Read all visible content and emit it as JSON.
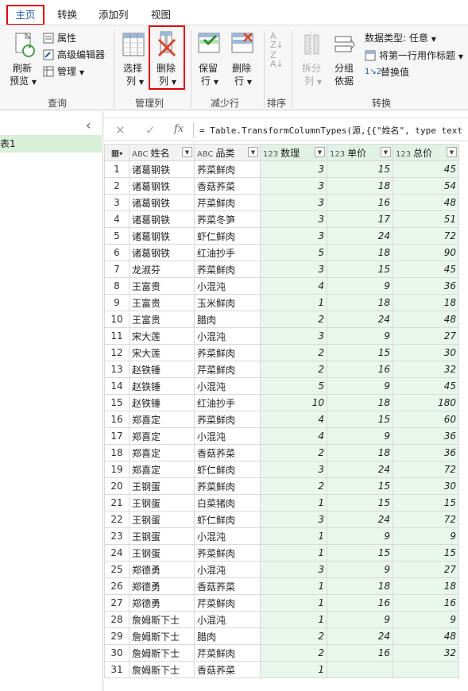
{
  "tabs": [
    {
      "label": "主页"
    },
    {
      "label": "转换"
    },
    {
      "label": "添加列"
    },
    {
      "label": "视图"
    }
  ],
  "ribbon": {
    "query": {
      "group_label": "查询",
      "refresh_line1": "刷新",
      "refresh_line2": "预览",
      "properties": "属性",
      "advanced_editor": "高级编辑器",
      "manage": "管理"
    },
    "manage_columns": {
      "group_label": "管理列",
      "choose_line1": "选择",
      "choose_line2": "列",
      "remove_line1": "删除",
      "remove_line2": "列"
    },
    "reduce_rows": {
      "group_label": "减少行",
      "keep_line1": "保留",
      "keep_line2": "行",
      "remove_line1": "删除",
      "remove_line2": "行"
    },
    "sort": {
      "group_label": "排序"
    },
    "transform": {
      "group_label": "转换",
      "split_line1": "拆分",
      "split_line2": "列",
      "group_line1": "分组",
      "group_line2": "依据",
      "data_type": "数据类型: 任意",
      "first_row_header": "将第一行用作标题",
      "replace_values": "替换值"
    }
  },
  "left_pane": {
    "query_name": "表1"
  },
  "formula_bar": {
    "text": "= Table.TransformColumnTypes(源,{{\"姓名\", type text"
  },
  "table": {
    "columns": [
      {
        "type": "ABC",
        "name": "姓名"
      },
      {
        "type": "ABC",
        "name": "品类"
      },
      {
        "type": "123",
        "name": "数理"
      },
      {
        "type": "123",
        "name": "单价"
      },
      {
        "type": "123",
        "name": "总价"
      }
    ],
    "rows": [
      [
        "1",
        "诸葛钢铁",
        "荞菜鲜肉",
        "3",
        "15",
        "45"
      ],
      [
        "2",
        "诸葛钢铁",
        "香菇荞菜",
        "3",
        "18",
        "54"
      ],
      [
        "3",
        "诸葛钢铁",
        "芹菜鲜肉",
        "3",
        "16",
        "48"
      ],
      [
        "4",
        "诸葛钢铁",
        "荞菜冬笋",
        "3",
        "17",
        "51"
      ],
      [
        "5",
        "诸葛钢铁",
        "虾仁鲜肉",
        "3",
        "24",
        "72"
      ],
      [
        "6",
        "诸葛钢铁",
        "红油抄手",
        "5",
        "18",
        "90"
      ],
      [
        "7",
        "龙淑芬",
        "荞菜鲜肉",
        "3",
        "15",
        "45"
      ],
      [
        "8",
        "王富贵",
        "小混沌",
        "4",
        "9",
        "36"
      ],
      [
        "9",
        "王富贵",
        "玉米鲜肉",
        "1",
        "18",
        "18"
      ],
      [
        "10",
        "王富贵",
        "腊肉",
        "2",
        "24",
        "48"
      ],
      [
        "11",
        "宋大莲",
        "小混沌",
        "3",
        "9",
        "27"
      ],
      [
        "12",
        "宋大莲",
        "荞菜鲜肉",
        "2",
        "15",
        "30"
      ],
      [
        "13",
        "赵铁锤",
        "芹菜鲜肉",
        "2",
        "16",
        "32"
      ],
      [
        "14",
        "赵铁锤",
        "小混沌",
        "5",
        "9",
        "45"
      ],
      [
        "15",
        "赵铁锤",
        "红油抄手",
        "10",
        "18",
        "180"
      ],
      [
        "16",
        "郑喜定",
        "荞菜鲜肉",
        "4",
        "15",
        "60"
      ],
      [
        "17",
        "郑喜定",
        "小混沌",
        "4",
        "9",
        "36"
      ],
      [
        "18",
        "郑喜定",
        "香菇荞菜",
        "2",
        "18",
        "36"
      ],
      [
        "19",
        "郑喜定",
        "虾仁鲜肉",
        "3",
        "24",
        "72"
      ],
      [
        "20",
        "王钢蛋",
        "荞菜鲜肉",
        "2",
        "15",
        "30"
      ],
      [
        "21",
        "王钢蛋",
        "白菜猪肉",
        "1",
        "15",
        "15"
      ],
      [
        "22",
        "王钢蛋",
        "虾仁鲜肉",
        "3",
        "24",
        "72"
      ],
      [
        "23",
        "王钢蛋",
        "小混沌",
        "1",
        "9",
        "9"
      ],
      [
        "24",
        "王钢蛋",
        "荞菜鲜肉",
        "1",
        "15",
        "15"
      ],
      [
        "25",
        "郑德勇",
        "小混沌",
        "3",
        "9",
        "27"
      ],
      [
        "26",
        "郑德勇",
        "香菇荞菜",
        "1",
        "18",
        "18"
      ],
      [
        "27",
        "郑德勇",
        "芹菜鲜肉",
        "1",
        "16",
        "16"
      ],
      [
        "28",
        "詹姆斯下士",
        "小混沌",
        "1",
        "9",
        "9"
      ],
      [
        "29",
        "詹姆斯下士",
        "腊肉",
        "2",
        "24",
        "48"
      ],
      [
        "30",
        "詹姆斯下士",
        "芹菜鲜肉",
        "2",
        "16",
        "32"
      ],
      [
        "31",
        "詹姆斯下士",
        "香菇荞菜",
        "1",
        "",
        ""
      ]
    ]
  }
}
